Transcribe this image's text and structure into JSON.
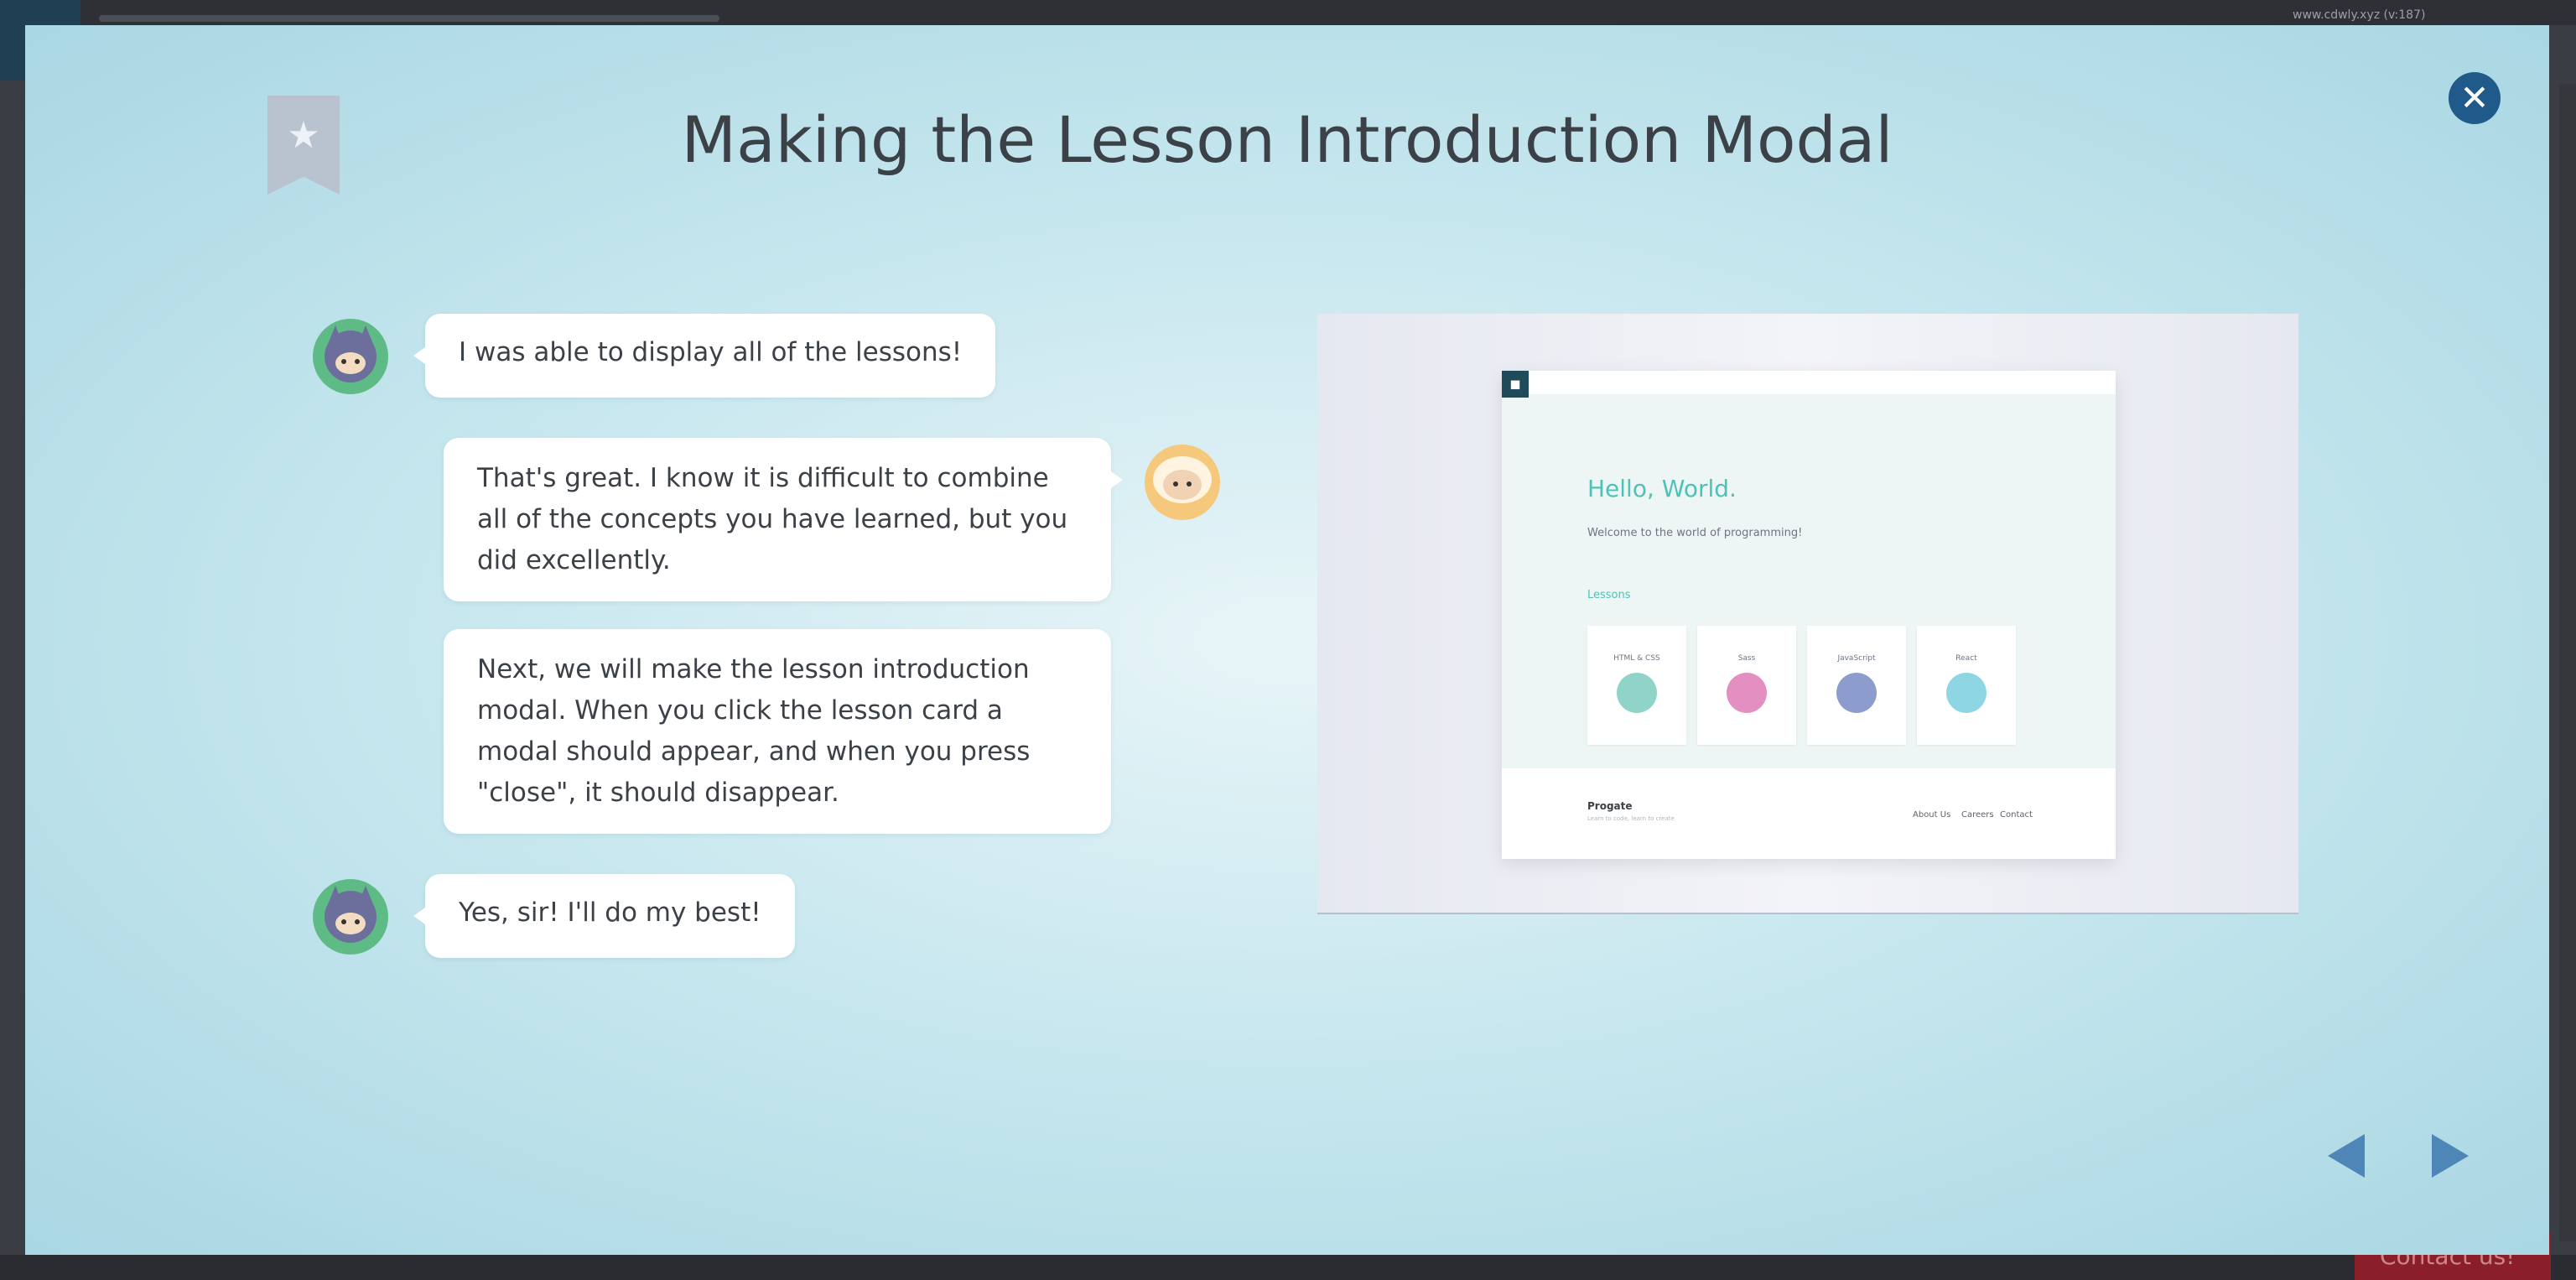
{
  "background": {
    "url_text": "www.cdwly.xyz (v:187)",
    "contact_label": "Contact us!"
  },
  "modal": {
    "title": "Making the Lesson Introduction Modal",
    "close_icon": "close-icon",
    "bookmark_icon": "bookmark-star-icon",
    "accent_color": "#1f5a8a",
    "messages": [
      {
        "speaker": "ninja",
        "side": "left",
        "text": "I was able to display all of the lessons!"
      },
      {
        "speaker": "sheep",
        "side": "right",
        "text": "That's great. I know it is difficult to combine all of the concepts you have learned, but you did excellently."
      },
      {
        "speaker": "sheep",
        "side": "right",
        "text": "Next, we will make the lesson introduction modal. When you click the lesson card a modal should appear, and when you press \"close\", it should disappear."
      },
      {
        "speaker": "ninja",
        "side": "left",
        "text": "Yes, sir! I'll do my best!"
      }
    ],
    "preview": {
      "hero_title": "Hello, World.",
      "hero_subtitle": "Welcome to the world of programming!",
      "lessons_heading": "Lessons",
      "cards": [
        {
          "label": "HTML & CSS",
          "color": "#8fd3c9"
        },
        {
          "label": "Sass",
          "color": "#e48fc1"
        },
        {
          "label": "JavaScript",
          "color": "#8c9ccc"
        },
        {
          "label": "React",
          "color": "#8fd6e4"
        }
      ],
      "footer_brand": "Progate",
      "footer_sub": "Learn to code, learn to create",
      "footer_links": [
        "About Us",
        "Careers",
        "Contact"
      ]
    },
    "nav": {
      "prev_icon": "prev-arrow-icon",
      "next_icon": "next-arrow-icon"
    }
  }
}
